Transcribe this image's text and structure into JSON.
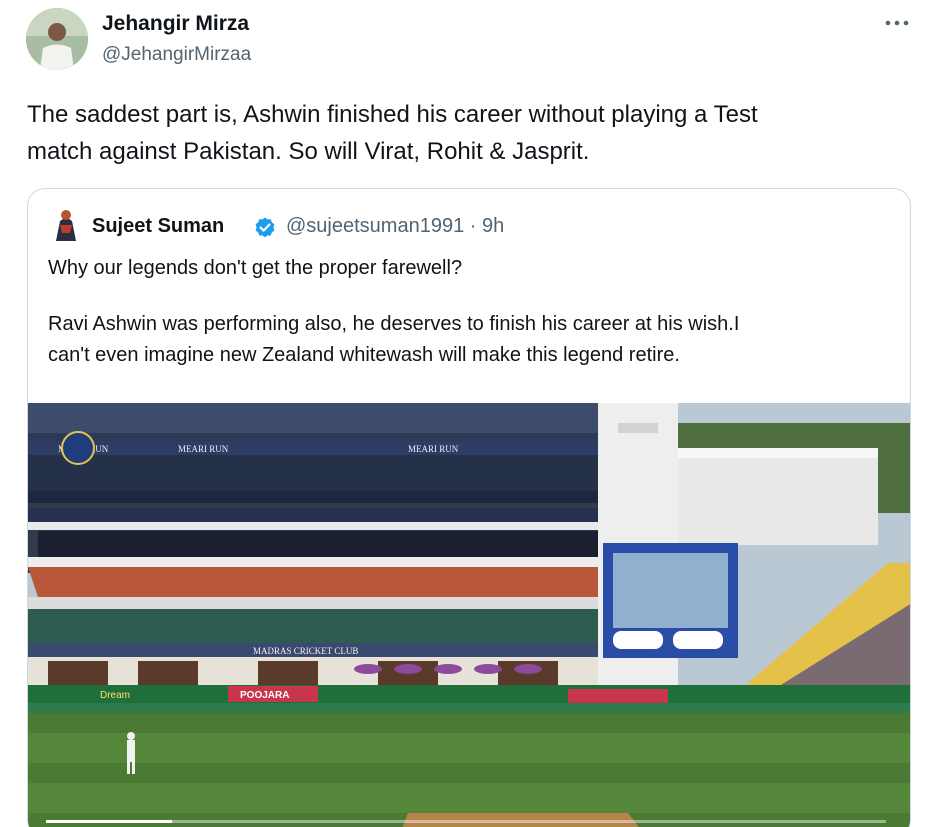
{
  "tweet": {
    "author_name": "Jehangir Mirza",
    "author_handle": "@JehangirMirzaa",
    "more_icon": "more-horizontal-icon",
    "text": "The saddest part is, Ashwin finished his career without playing a Test\nmatch against Pakistan. So will Virat, Rohit & Jasprit."
  },
  "quote": {
    "author_name": "Sujeet Suman",
    "verified_icon": "verified-badge-icon",
    "handle": "@sujeetsuman1991",
    "separator": "·",
    "time": "9h",
    "paragraph1": "Why our legends don't get the proper farewell?",
    "paragraph2_line1": "Ravi Ashwin was performing also, he deserves to finish his career at his wish.I",
    "paragraph2_line2": "can't even imagine new Zealand whitewash will make this legend retire."
  },
  "media": {
    "type": "video",
    "progress_fraction": 0.15,
    "signage": {
      "sponsor": "MEARI RUN",
      "club": "MADRAS CRICKET CLUB",
      "poojara": "POOJARA",
      "dream": "Dream"
    }
  },
  "colors": {
    "text_primary": "#0f1419",
    "text_secondary": "#536471",
    "border": "#cfd9de",
    "verified_blue": "#1d9bf0"
  }
}
